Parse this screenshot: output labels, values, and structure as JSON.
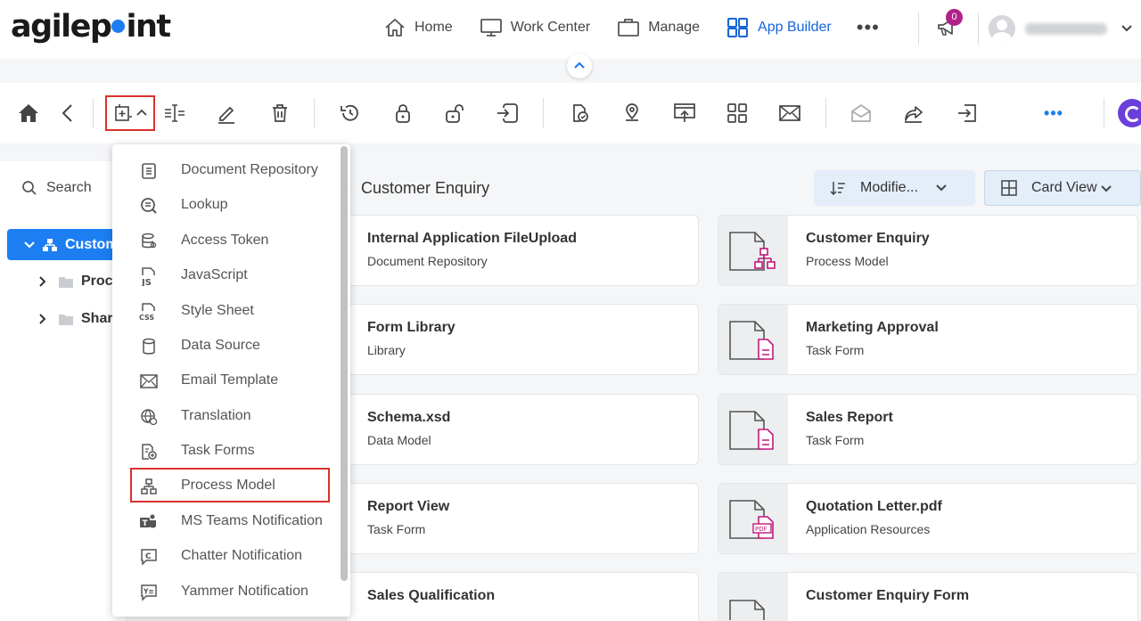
{
  "logo": {
    "text_pre": "agilep",
    "text_post": "int"
  },
  "nav": {
    "items": [
      {
        "label": "Home",
        "icon": "home-icon"
      },
      {
        "label": "Work Center",
        "icon": "monitor-icon"
      },
      {
        "label": "Manage",
        "icon": "briefcase-icon"
      },
      {
        "label": "App Builder",
        "icon": "grid-icon",
        "active": true
      }
    ],
    "more": "•••",
    "notification_count": "0"
  },
  "left": {
    "search_label": "Search",
    "tree": [
      {
        "label": "Custom",
        "selected": true
      },
      {
        "label": "Proce"
      },
      {
        "label": "Share"
      }
    ]
  },
  "main": {
    "heading": "Customer Enquiry",
    "sort_label": "Modifie...",
    "view_label": "Card View",
    "cards": [
      {
        "title": "Internal Application FileUpload",
        "subtitle": "Document Repository"
      },
      {
        "title": "Customer Enquiry",
        "subtitle": "Process Model",
        "thumb": "process-model-icon"
      },
      {
        "title": "Form Library",
        "subtitle": "Library"
      },
      {
        "title": "Marketing Approval",
        "subtitle": "Task Form",
        "thumb": "task-form-icon"
      },
      {
        "title": "Schema.xsd",
        "subtitle": "Data Model"
      },
      {
        "title": "Sales Report",
        "subtitle": "Task Form",
        "thumb": "task-form-icon"
      },
      {
        "title": "Report View",
        "subtitle": "Task Form"
      },
      {
        "title": "Quotation Letter.pdf",
        "subtitle": "Application Resources",
        "thumb": "pdf-icon"
      },
      {
        "title": "Sales Qualification",
        "subtitle": ""
      },
      {
        "title": "Customer Enquiry Form",
        "subtitle": "",
        "thumb": "task-form-icon"
      }
    ]
  },
  "dropdown": {
    "items": [
      "Document Repository",
      "Lookup",
      "Access Token",
      "JavaScript",
      "Style Sheet",
      "Data Source",
      "Email Template",
      "Translation",
      "Task Forms",
      "Process Model",
      "MS Teams Notification",
      "Chatter Notification",
      "Yammer Notification"
    ],
    "highlighted": "Process Model"
  },
  "colors": {
    "primary": "#1d7ef2",
    "active_nav": "#1565d8",
    "badge": "#b0228a",
    "highlight_border": "#d9312b",
    "thumb_accent": "#c2187c"
  }
}
